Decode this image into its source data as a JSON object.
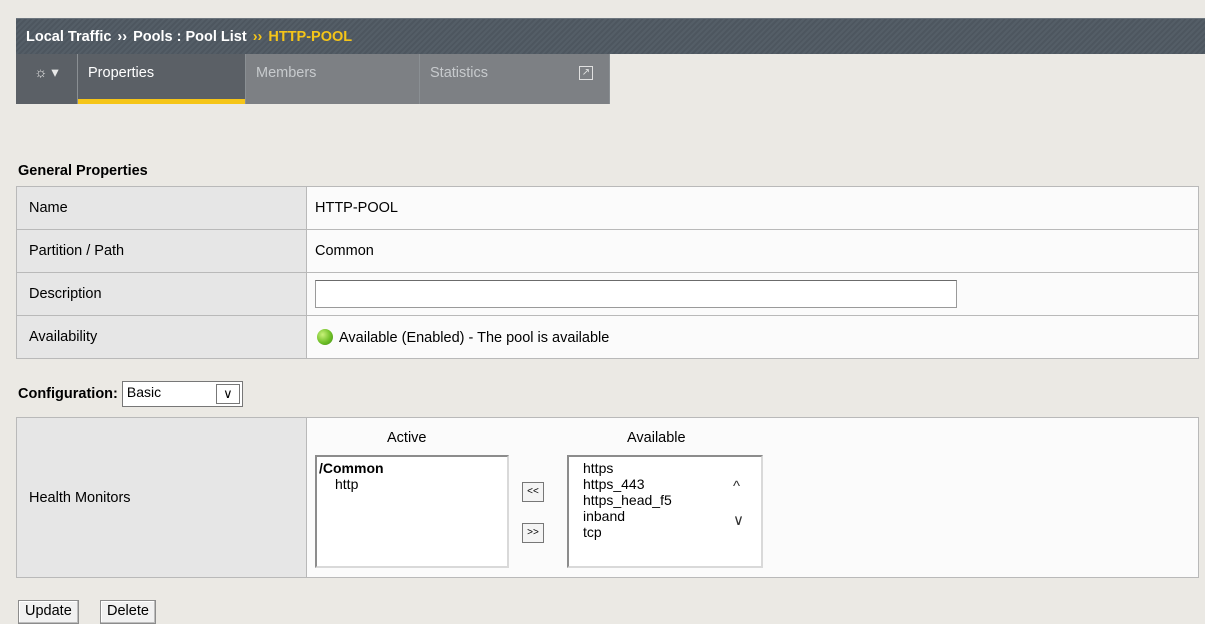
{
  "breadcrumb": {
    "part1": "Local Traffic",
    "sep1": "››",
    "part2": "Pools : Pool List",
    "sep2": "››",
    "current": "HTTP-POOL"
  },
  "tabs": {
    "gear": "☼ ▾",
    "properties": "Properties",
    "members": "Members",
    "statistics": "Statistics",
    "external_icon": "↗"
  },
  "general": {
    "title": "General Properties",
    "rows": {
      "name_label": "Name",
      "name_value": "HTTP-POOL",
      "partition_label": "Partition / Path",
      "partition_value": "Common",
      "description_label": "Description",
      "description_value": "",
      "availability_label": "Availability",
      "availability_value": "Available (Enabled) - The pool is available"
    }
  },
  "configuration": {
    "label": "Configuration:",
    "selected": "Basic",
    "arrow": "∨"
  },
  "health_monitors": {
    "label": "Health Monitors",
    "active_header": "Active",
    "available_header": "Available",
    "active_group": "/Common",
    "active_items": [
      "http"
    ],
    "available_items": [
      "https",
      "https_443",
      "https_head_f5",
      "inband",
      "tcp"
    ],
    "move_left": "<<",
    "move_right": ">>",
    "scroll_up": "^",
    "scroll_down": "∨"
  },
  "actions": {
    "update": "Update",
    "delete": "Delete"
  },
  "colors": {
    "accent": "#f5c518",
    "header_bg": "#4f5962",
    "status_green": "#6fbf27"
  }
}
